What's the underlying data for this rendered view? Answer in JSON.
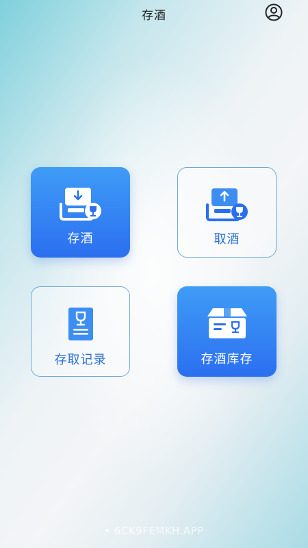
{
  "header": {
    "title": "存酒",
    "profile_icon": "user-circle-icon"
  },
  "tiles": [
    {
      "label": "存酒",
      "icon": "deposit-tray-wine-icon",
      "style": "filled"
    },
    {
      "label": "取酒",
      "icon": "withdraw-tray-wine-icon",
      "style": "outline"
    },
    {
      "label": "存取记录",
      "icon": "wine-record-document-icon",
      "style": "outline"
    },
    {
      "label": "存酒库存",
      "icon": "wine-box-inventory-icon",
      "style": "filled"
    }
  ],
  "watermark": "• 6CK9FEMKH.APP",
  "colors": {
    "primary_blue": "#2b6ff0",
    "light_blue": "#3f9cf6",
    "outline_border": "#6ea9d8",
    "outline_text": "#2c6fd6"
  }
}
